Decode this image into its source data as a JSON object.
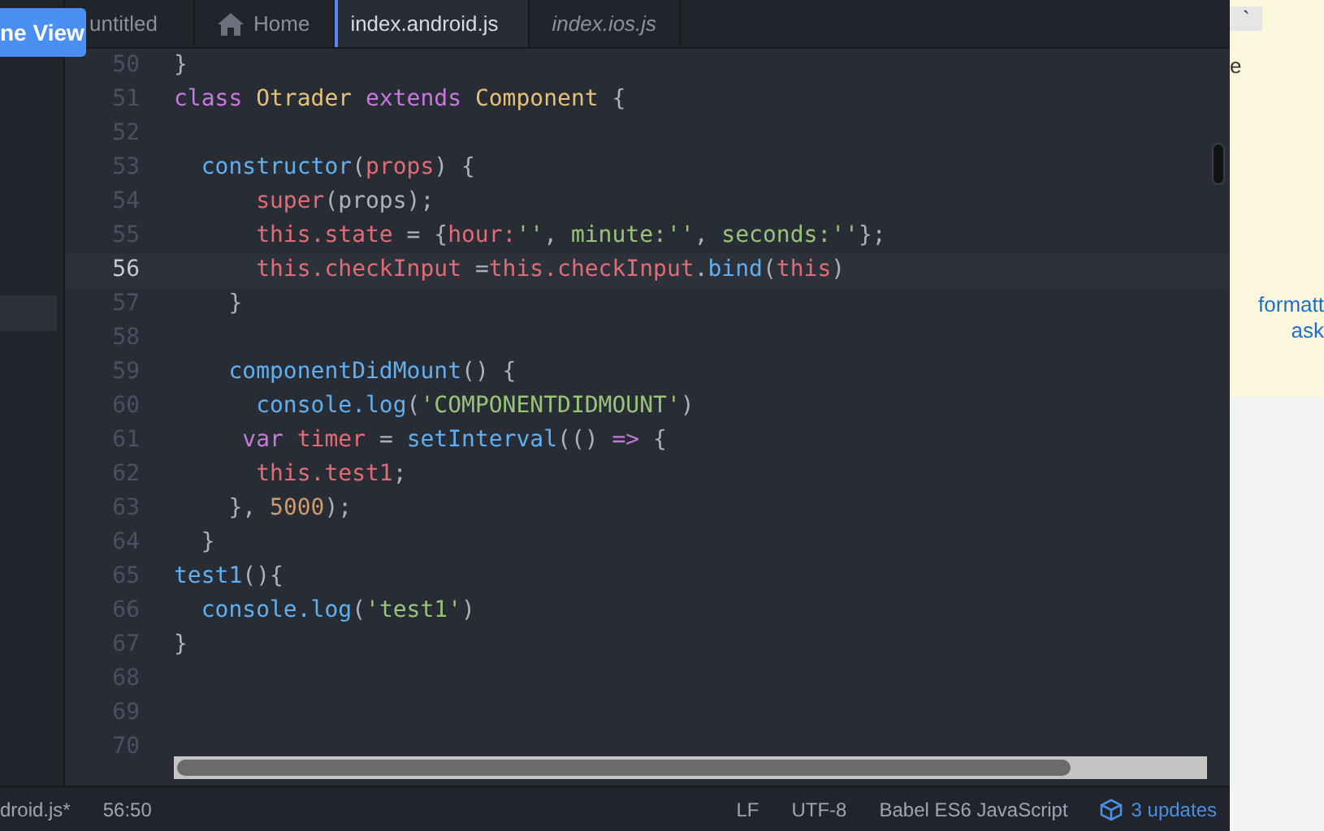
{
  "overlay_button": {
    "label": "ne View"
  },
  "tabs": [
    {
      "label": "untitled",
      "selected": false,
      "italic": false,
      "home": false
    },
    {
      "label": "Home",
      "selected": false,
      "italic": false,
      "home": true
    },
    {
      "label": "index.android.js",
      "selected": true,
      "italic": false,
      "home": false
    },
    {
      "label": "index.ios.js",
      "selected": false,
      "italic": true,
      "home": false
    }
  ],
  "lines": [
    {
      "number": "50",
      "current": false,
      "tokens": [
        {
          "kind": "plain",
          "text": "}"
        }
      ]
    },
    {
      "number": "51",
      "current": false,
      "tokens": [
        {
          "kind": "keyword",
          "text": "class "
        },
        {
          "kind": "class",
          "text": "Otrader "
        },
        {
          "kind": "keyword",
          "text": "extends "
        },
        {
          "kind": "class",
          "text": "Component "
        },
        {
          "kind": "plain",
          "text": "{"
        }
      ]
    },
    {
      "number": "52",
      "current": false
    },
    {
      "number": "53",
      "current": false,
      "tokens": [
        {
          "kind": "func",
          "text": "  constructor"
        },
        {
          "kind": "plain",
          "text": "("
        },
        {
          "kind": "var",
          "text": "props"
        },
        {
          "kind": "plain",
          "text": ") {"
        }
      ]
    },
    {
      "number": "54",
      "current": false,
      "tokens": [
        {
          "kind": "var",
          "text": "      super"
        },
        {
          "kind": "plain",
          "text": "(props);"
        }
      ]
    },
    {
      "number": "55",
      "current": false,
      "tokens": [
        {
          "kind": "var",
          "text": "      this.state"
        },
        {
          "kind": "plain",
          "text": " = {"
        },
        {
          "kind": "var",
          "text": "hour:"
        },
        {
          "kind": "string",
          "text": "''"
        },
        {
          "kind": "plain",
          "text": ", "
        },
        {
          "kind": "string",
          "text": "minute:''"
        },
        {
          "kind": "plain",
          "text": ", "
        },
        {
          "kind": "string",
          "text": "seconds:''"
        },
        {
          "kind": "plain",
          "text": "};"
        }
      ]
    },
    {
      "number": "56",
      "current": true,
      "tokens": [
        {
          "kind": "var",
          "text": "      this.checkInput"
        },
        {
          "kind": "plain",
          "text": " ="
        },
        {
          "kind": "var",
          "text": "this.checkInput"
        },
        {
          "kind": "plain",
          "text": "."
        },
        {
          "kind": "func",
          "text": "bind"
        },
        {
          "kind": "plain",
          "text": "("
        },
        {
          "kind": "var",
          "text": "this"
        },
        {
          "kind": "plain",
          "text": ")"
        }
      ]
    },
    {
      "number": "57",
      "current": false,
      "tokens": [
        {
          "kind": "plain",
          "text": "    }"
        }
      ]
    },
    {
      "number": "58",
      "current": false
    },
    {
      "number": "59",
      "current": false,
      "tokens": [
        {
          "kind": "func",
          "text": "    componentDidMount"
        },
        {
          "kind": "plain",
          "text": "() {"
        }
      ]
    },
    {
      "number": "60",
      "current": false,
      "tokens": [
        {
          "kind": "func",
          "text": "      console.log"
        },
        {
          "kind": "plain",
          "text": "("
        },
        {
          "kind": "string",
          "text": "'COMPONENTDIDMOUNT'"
        },
        {
          "kind": "plain",
          "text": ")"
        }
      ]
    },
    {
      "number": "61",
      "current": false,
      "tokens": [
        {
          "kind": "keyword",
          "text": "     var "
        },
        {
          "kind": "var",
          "text": "timer"
        },
        {
          "kind": "plain",
          "text": " = "
        },
        {
          "kind": "func",
          "text": "setInterval"
        },
        {
          "kind": "plain",
          "text": "(() "
        },
        {
          "kind": "keyword",
          "text": "=>"
        },
        {
          "kind": "plain",
          "text": " {"
        }
      ]
    },
    {
      "number": "62",
      "current": false,
      "tokens": [
        {
          "kind": "var",
          "text": "      this.test1"
        },
        {
          "kind": "plain",
          "text": ";"
        }
      ]
    },
    {
      "number": "63",
      "current": false,
      "tokens": [
        {
          "kind": "plain",
          "text": "    }, "
        },
        {
          "kind": "number",
          "text": "5000"
        },
        {
          "kind": "plain",
          "text": ");"
        }
      ]
    },
    {
      "number": "64",
      "current": false,
      "tokens": [
        {
          "kind": "plain",
          "text": "  }"
        }
      ]
    },
    {
      "number": "65",
      "current": false,
      "tokens": [
        {
          "kind": "func",
          "text": "test1"
        },
        {
          "kind": "plain",
          "text": "(){"
        }
      ]
    },
    {
      "number": "66",
      "current": false,
      "tokens": [
        {
          "kind": "func",
          "text": "  console.log"
        },
        {
          "kind": "plain",
          "text": "("
        },
        {
          "kind": "string",
          "text": "'test1'"
        },
        {
          "kind": "plain",
          "text": ")"
        }
      ]
    },
    {
      "number": "67",
      "current": false,
      "tokens": [
        {
          "kind": "plain",
          "text": "}"
        }
      ]
    },
    {
      "number": "68",
      "current": false
    },
    {
      "number": "69",
      "current": false
    },
    {
      "number": "70",
      "current": false
    }
  ],
  "status_bar": {
    "file": "droid.js*",
    "cursor": "56:50",
    "line_ending": "LF",
    "encoding": "UTF-8",
    "grammar": "Babel ES6 JavaScript",
    "updates": "3 updates"
  },
  "right_panel": {
    "texts": [
      "`",
      "e"
    ],
    "link_lines": [
      "formatt",
      "ask"
    ]
  }
}
